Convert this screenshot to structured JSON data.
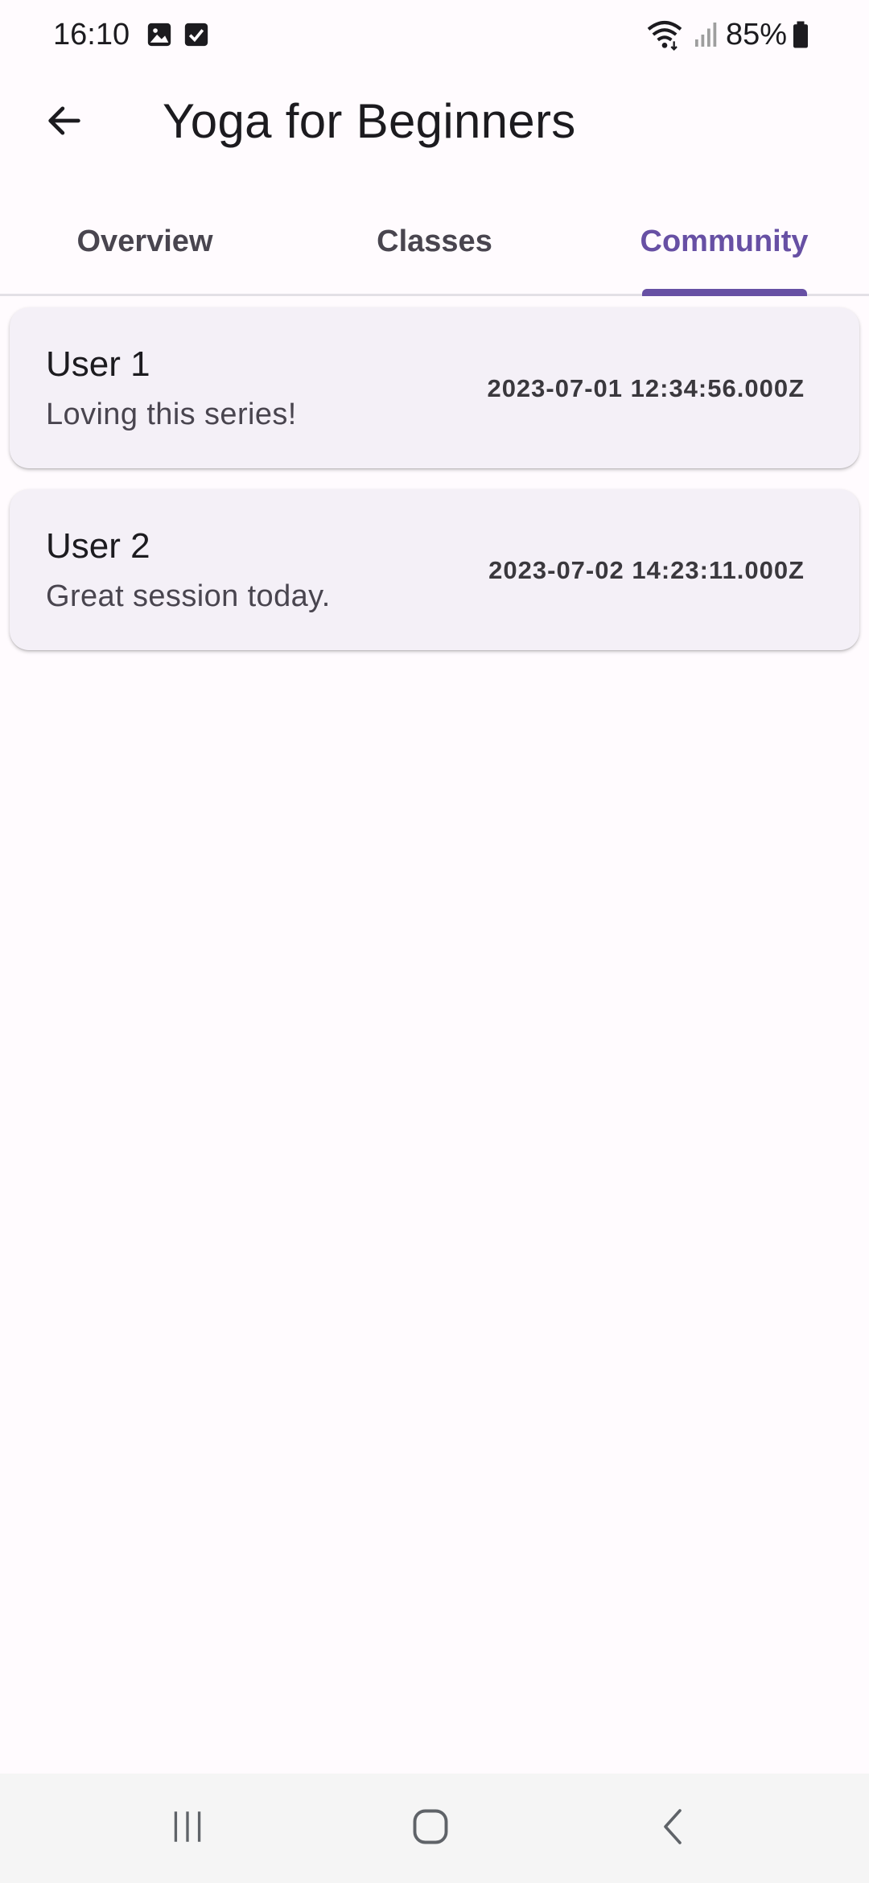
{
  "status_bar": {
    "time": "16:10",
    "battery_percent": "85%",
    "icons": [
      "image-icon",
      "checkbox-icon",
      "wifi-icon",
      "signal-icon",
      "battery-icon"
    ]
  },
  "app_bar": {
    "title": "Yoga for Beginners",
    "back_icon": "arrow-back-icon"
  },
  "tabs": [
    {
      "label": "Overview",
      "active": false
    },
    {
      "label": "Classes",
      "active": false
    },
    {
      "label": "Community",
      "active": true
    }
  ],
  "posts": [
    {
      "user": "User 1",
      "message": "Loving this series!",
      "timestamp": "2023-07-01 12:34:56.000Z"
    },
    {
      "user": "User 2",
      "message": "Great session today.",
      "timestamp": "2023-07-02 14:23:11.000Z"
    }
  ],
  "nav_bar": {
    "icons": [
      "recent-apps-icon",
      "home-icon",
      "back-icon"
    ]
  },
  "colors": {
    "accent": "#6750a4",
    "background": "#fffbfe",
    "card": "#f4f0f7",
    "nav_bar": "#f5f5f5"
  }
}
